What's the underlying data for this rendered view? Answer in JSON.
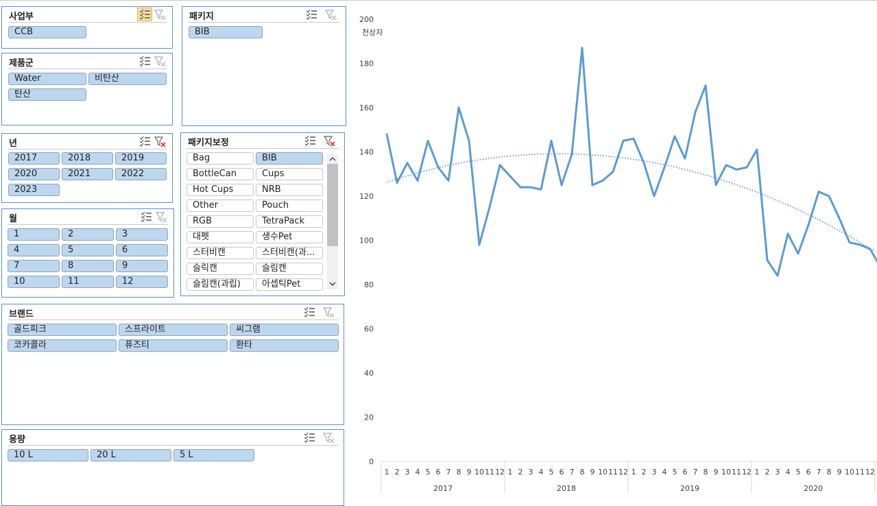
{
  "slicers": {
    "business": {
      "title": "사업부",
      "items": [
        "CCB"
      ]
    },
    "package": {
      "title": "패키지",
      "items": [
        "BIB"
      ]
    },
    "product_group": {
      "title": "제품군",
      "items": [
        "Water",
        "비탄산",
        "탄산"
      ]
    },
    "year": {
      "title": "년",
      "items": [
        "2017",
        "2018",
        "2019",
        "2020",
        "2021",
        "2022",
        "2023"
      ]
    },
    "package_corr": {
      "title": "패키지보정",
      "items": [
        {
          "label": "Bag",
          "selected": false
        },
        {
          "label": "BIB",
          "selected": true
        },
        {
          "label": "BottleCan",
          "selected": false
        },
        {
          "label": "Cups",
          "selected": false
        },
        {
          "label": "Hot Cups",
          "selected": false
        },
        {
          "label": "NRB",
          "selected": false
        },
        {
          "label": "Other",
          "selected": false
        },
        {
          "label": "Pouch",
          "selected": false
        },
        {
          "label": "RGB",
          "selected": false
        },
        {
          "label": "TetraPack",
          "selected": false
        },
        {
          "label": "대펫",
          "selected": false
        },
        {
          "label": "생수Pet",
          "selected": false
        },
        {
          "label": "스터비캔",
          "selected": false
        },
        {
          "label": "스터비캔(과...",
          "selected": false
        },
        {
          "label": "슬릭캔",
          "selected": false
        },
        {
          "label": "슬림캔",
          "selected": false
        },
        {
          "label": "슬림캔(과립)",
          "selected": false
        },
        {
          "label": "아셉틱Pet",
          "selected": false
        }
      ]
    },
    "month": {
      "title": "월",
      "items": [
        "1",
        "2",
        "3",
        "4",
        "5",
        "6",
        "7",
        "8",
        "9",
        "10",
        "11",
        "12"
      ]
    },
    "brand": {
      "title": "브랜드",
      "items": [
        "골드피크",
        "스프라이트",
        "씨그램",
        "코카콜라",
        "퓨즈티",
        "환타"
      ]
    },
    "volume": {
      "title": "용량",
      "items": [
        "10 L",
        "20 L",
        "5 L"
      ]
    }
  },
  "icons": {
    "multi_select": "multi-select-icon",
    "clear_filter": "clear-filter-icon"
  },
  "colors": {
    "accent": "#5b9bd5",
    "slicer_item": "#bdd7ee",
    "slicer_border": "#5b8fc9"
  },
  "chart_data": {
    "type": "line",
    "ylabel": "천상자",
    "ylim": [
      0,
      200
    ],
    "yticks": [
      0,
      20,
      40,
      60,
      80,
      100,
      120,
      140,
      160,
      180,
      200
    ],
    "month_labels": [
      "1",
      "2",
      "3",
      "4",
      "5",
      "6",
      "7",
      "8",
      "9",
      "10",
      "11",
      "12"
    ],
    "year_labels": [
      "2017",
      "2018",
      "2019",
      "2020"
    ],
    "series": [
      {
        "values": [
          148,
          126,
          135,
          127,
          145,
          133,
          127,
          160,
          145,
          98,
          115,
          134,
          129,
          124,
          124,
          123,
          145,
          125,
          139,
          187,
          125,
          127,
          131,
          145,
          146,
          135,
          120,
          133,
          147,
          137,
          158,
          170,
          125,
          134,
          132,
          133,
          141,
          91,
          84,
          103,
          94,
          107,
          122,
          120,
          110,
          99,
          98,
          96,
          88
        ]
      }
    ],
    "trendline": {
      "style": "dotted",
      "type": "polynomial"
    }
  }
}
